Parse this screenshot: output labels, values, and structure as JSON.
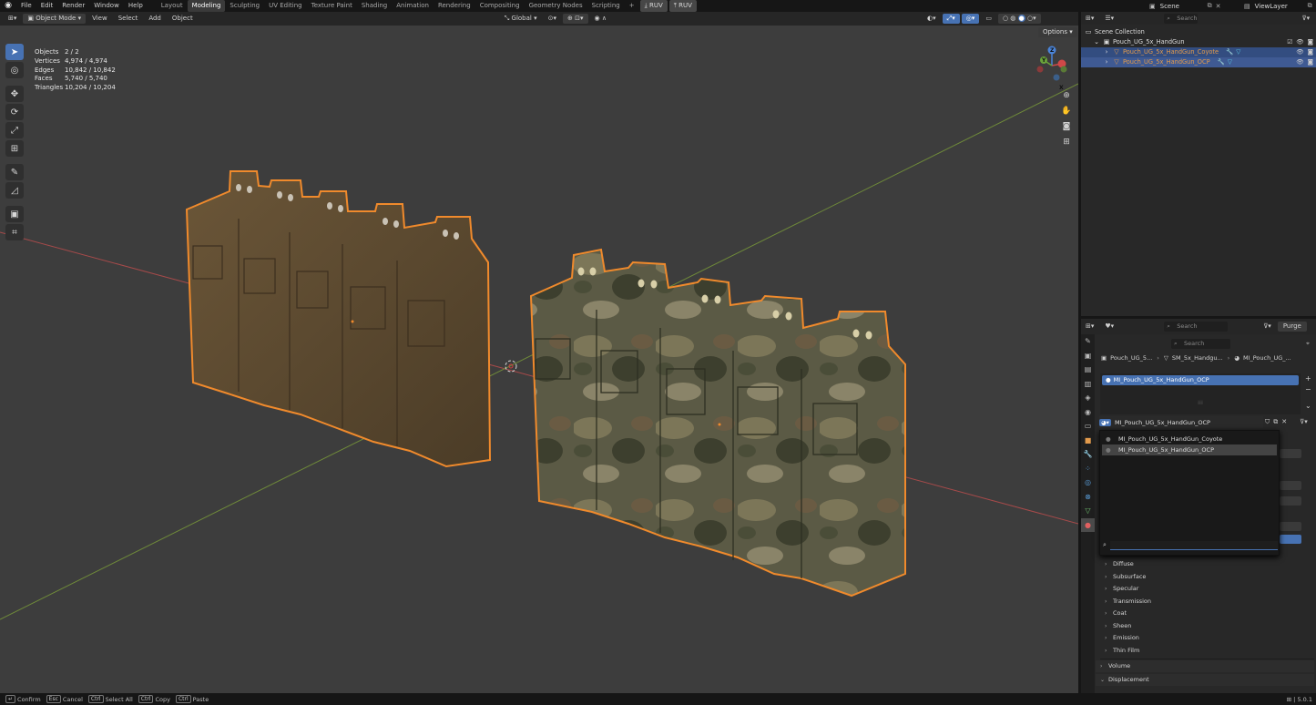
{
  "topbar": {
    "menus": [
      "File",
      "Edit",
      "Render",
      "Window",
      "Help"
    ],
    "workspaces": [
      "Layout",
      "Modeling",
      "Sculpting",
      "UV Editing",
      "Texture Paint",
      "Shading",
      "Animation",
      "Rendering",
      "Compositing",
      "Geometry Nodes",
      "Scripting"
    ],
    "active_workspace": "Modeling",
    "plus": "+",
    "ruv_buttons": [
      "RUV",
      "RUV"
    ],
    "scene_label": "Scene",
    "viewlayer_label": "ViewLayer"
  },
  "viewport_header": {
    "mode": "Object Mode",
    "menus": [
      "View",
      "Select",
      "Add",
      "Object"
    ],
    "orientation": "Global",
    "options": "Options"
  },
  "stats": {
    "rows": [
      {
        "label": "Objects",
        "value": "2 / 2"
      },
      {
        "label": "Vertices",
        "value": "4,974 / 4,974"
      },
      {
        "label": "Edges",
        "value": "10,842 / 10,842"
      },
      {
        "label": "Faces",
        "value": "5,740 / 5,740"
      },
      {
        "label": "Triangles",
        "value": "10,204 / 10,204"
      }
    ]
  },
  "gizmo": {
    "x": "X",
    "y": "Y",
    "z": "Z"
  },
  "outliner": {
    "search_placeholder": "Search",
    "scene_collection": "Scene Collection",
    "collection": "Pouch_UG_5x_HandGun",
    "objects": [
      "Pouch_UG_5x_HandGun_Coyote",
      "Pouch_UG_5x_HandGun_OCP"
    ]
  },
  "properties": {
    "search_placeholder": "Search",
    "purge": "Purge",
    "inner_search_placeholder": "Search",
    "breadcrumb": [
      "Pouch_UG_5...",
      "SM_5x_Handgu...",
      "MI_Pouch_UG_..."
    ],
    "slot_name": "MI_Pouch_UG_5x_HandGun_OCP",
    "material_field": "MI_Pouch_UG_5x_HandGun_OCP",
    "dropdown_items": [
      "MI_Pouch_UG_5x_HandGun_Coyote",
      "MI_Pouch_UG_5x_HandGun_OCP"
    ],
    "panels": [
      "Diffuse",
      "Subsurface",
      "Specular",
      "Transmission",
      "Coat",
      "Sheen",
      "Emission",
      "Thin Film"
    ],
    "panels_bottom": [
      "Volume",
      "Displacement"
    ]
  },
  "statusbar": {
    "items": [
      {
        "key": "↵",
        "label": "Confirm"
      },
      {
        "key": "Esc",
        "label": "Cancel"
      },
      {
        "key": "Ctrl",
        "label": "Select All"
      },
      {
        "key": "Ctrl",
        "label": "Copy"
      },
      {
        "key": "Ctrl",
        "label": "Paste"
      }
    ],
    "version": "5.0.1"
  },
  "colors": {
    "accent": "#4772b3",
    "selection_outline": "#f08a2c",
    "coyote": "#5a4630",
    "ocp": "#5b5a45"
  }
}
